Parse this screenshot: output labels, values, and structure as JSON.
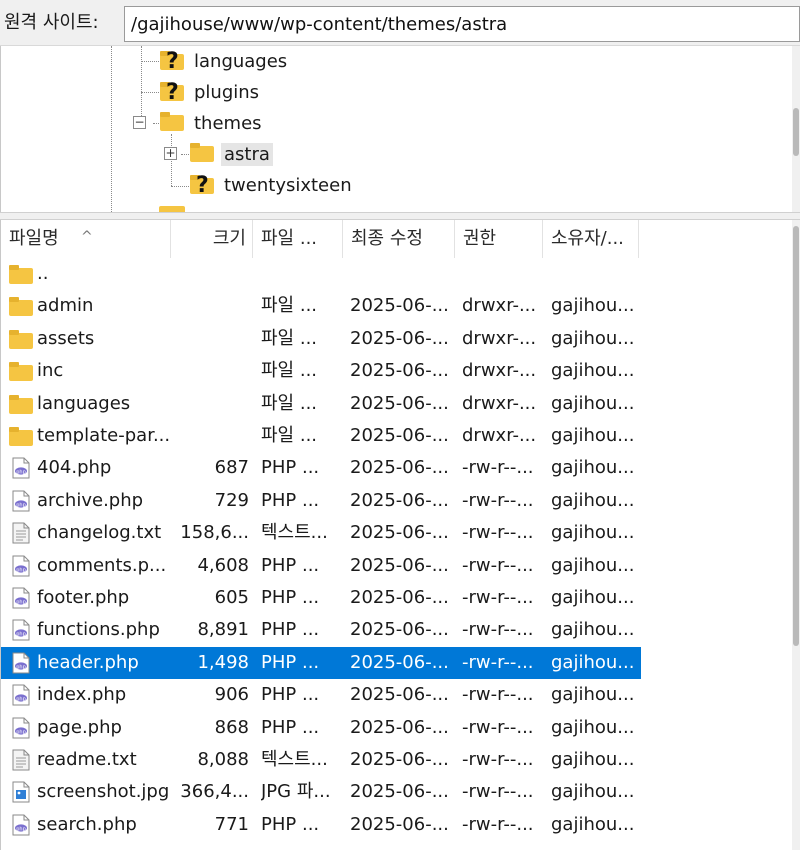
{
  "address_bar": {
    "label": "원격 사이트:",
    "path": "/gajihouse/www/wp-content/themes/astra"
  },
  "tree": {
    "items": [
      {
        "label": "languages",
        "icon": "unknown-folder-icon"
      },
      {
        "label": "plugins",
        "icon": "unknown-folder-icon"
      },
      {
        "label": "themes",
        "icon": "folder-icon"
      },
      {
        "label": "astra",
        "icon": "folder-icon"
      },
      {
        "label": "twentysixteen",
        "icon": "unknown-folder-icon"
      }
    ]
  },
  "list": {
    "headers": {
      "name": "파일명",
      "size": "크기",
      "type": "파일 ...",
      "modified": "최종 수정",
      "permissions": "권한",
      "owner": "소유자/..."
    },
    "sort_indicator": "^",
    "rows": [
      {
        "name": "..",
        "size": "",
        "type": "",
        "modified": "",
        "permissions": "",
        "owner": "",
        "icon": "folder-icon"
      },
      {
        "name": "admin",
        "size": "",
        "type": "파일 ...",
        "modified": "2025-06-...",
        "permissions": "drwxr-...",
        "owner": "gajihou...",
        "icon": "folder-icon"
      },
      {
        "name": "assets",
        "size": "",
        "type": "파일 ...",
        "modified": "2025-06-...",
        "permissions": "drwxr-...",
        "owner": "gajihou...",
        "icon": "folder-icon"
      },
      {
        "name": "inc",
        "size": "",
        "type": "파일 ...",
        "modified": "2025-06-...",
        "permissions": "drwxr-...",
        "owner": "gajihou...",
        "icon": "folder-icon"
      },
      {
        "name": "languages",
        "size": "",
        "type": "파일 ...",
        "modified": "2025-06-...",
        "permissions": "drwxr-...",
        "owner": "gajihou...",
        "icon": "folder-icon"
      },
      {
        "name": "template-par...",
        "size": "",
        "type": "파일 ...",
        "modified": "2025-06-...",
        "permissions": "drwxr-...",
        "owner": "gajihou...",
        "icon": "folder-icon"
      },
      {
        "name": "404.php",
        "size": "687",
        "type": "PHP ...",
        "modified": "2025-06-...",
        "permissions": "-rw-r--...",
        "owner": "gajihou...",
        "icon": "php-file-icon"
      },
      {
        "name": "archive.php",
        "size": "729",
        "type": "PHP ...",
        "modified": "2025-06-...",
        "permissions": "-rw-r--...",
        "owner": "gajihou...",
        "icon": "php-file-icon"
      },
      {
        "name": "changelog.txt",
        "size": "158,6...",
        "type": "텍스트...",
        "modified": "2025-06-...",
        "permissions": "-rw-r--...",
        "owner": "gajihou...",
        "icon": "text-file-icon"
      },
      {
        "name": "comments.p...",
        "size": "4,608",
        "type": "PHP ...",
        "modified": "2025-06-...",
        "permissions": "-rw-r--...",
        "owner": "gajihou...",
        "icon": "php-file-icon"
      },
      {
        "name": "footer.php",
        "size": "605",
        "type": "PHP ...",
        "modified": "2025-06-...",
        "permissions": "-rw-r--...",
        "owner": "gajihou...",
        "icon": "php-file-icon"
      },
      {
        "name": "functions.php",
        "size": "8,891",
        "type": "PHP ...",
        "modified": "2025-06-...",
        "permissions": "-rw-r--...",
        "owner": "gajihou...",
        "icon": "php-file-icon"
      },
      {
        "name": "header.php",
        "size": "1,498",
        "type": "PHP ...",
        "modified": "2025-06-...",
        "permissions": "-rw-r--...",
        "owner": "gajihou...",
        "icon": "php-file-icon",
        "selected": true
      },
      {
        "name": "index.php",
        "size": "906",
        "type": "PHP ...",
        "modified": "2025-06-...",
        "permissions": "-rw-r--...",
        "owner": "gajihou...",
        "icon": "php-file-icon"
      },
      {
        "name": "page.php",
        "size": "868",
        "type": "PHP ...",
        "modified": "2025-06-...",
        "permissions": "-rw-r--...",
        "owner": "gajihou...",
        "icon": "php-file-icon"
      },
      {
        "name": "readme.txt",
        "size": "8,088",
        "type": "텍스트...",
        "modified": "2025-06-...",
        "permissions": "-rw-r--...",
        "owner": "gajihou...",
        "icon": "text-file-icon"
      },
      {
        "name": "screenshot.jpg",
        "size": "366,4...",
        "type": "JPG 파...",
        "modified": "2025-06-...",
        "permissions": "-rw-r--...",
        "owner": "gajihou...",
        "icon": "image-file-icon"
      },
      {
        "name": "search.php",
        "size": "771",
        "type": "PHP ...",
        "modified": "2025-06-...",
        "permissions": "-rw-r--...",
        "owner": "gajihou...",
        "icon": "php-file-icon"
      }
    ]
  },
  "colors": {
    "selection": "#0078d7",
    "folder": "#f5c542",
    "php_icon": "#7a6fcf"
  }
}
